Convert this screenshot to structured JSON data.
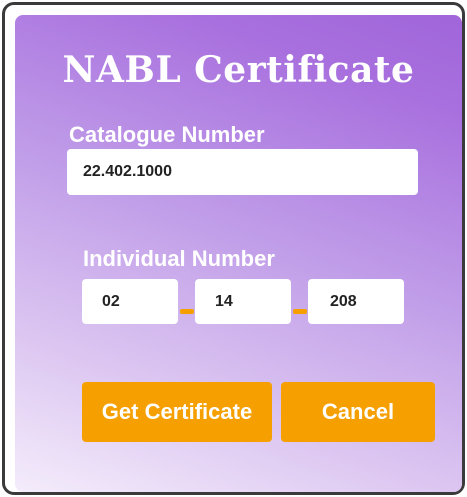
{
  "dialog": {
    "title": "NABL Certificate"
  },
  "catalogue": {
    "label": "Catalogue Number",
    "value": "22.402.1000"
  },
  "individual": {
    "label": "Individual Number",
    "parts": [
      "02",
      "14",
      "208"
    ]
  },
  "buttons": {
    "get_certificate": "Get Certificate",
    "cancel": "Cancel"
  },
  "colors": {
    "accent": "#f5a000",
    "panel_start": "#f4ecfb",
    "panel_end": "#a066da",
    "text": "#ffffff"
  }
}
